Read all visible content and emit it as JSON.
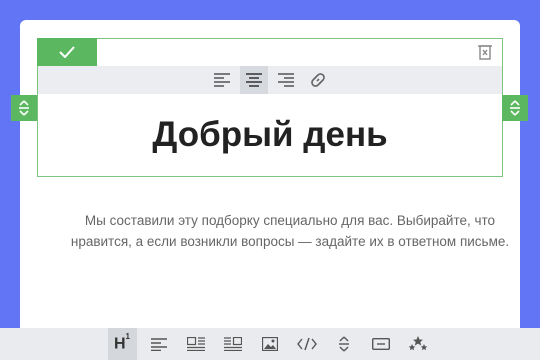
{
  "block": {
    "heading": "Добрый день",
    "done_icon": "check-icon",
    "delete_icon": "trash-icon",
    "format_buttons": [
      "align-left-icon",
      "align-center-icon",
      "align-right-icon",
      "link-icon"
    ],
    "active_format": "align-center-icon"
  },
  "paragraph": {
    "text": "Мы составили эту подборку специально для вас. Выбирайте, что нравится, а если возникли вопросы — задайте их в ответном письме."
  },
  "bottom_toolbar": {
    "heading_label": "H",
    "heading_sup": "1",
    "items": [
      "heading-icon",
      "text-icon",
      "image-left-text-icon",
      "image-right-text-icon",
      "image-icon",
      "code-icon",
      "spacer-icon",
      "button-icon",
      "rating-icon"
    ]
  },
  "colors": {
    "background": "#6276f5",
    "accent_green": "#5cb860",
    "toolbar_bg": "#e9ebee"
  }
}
